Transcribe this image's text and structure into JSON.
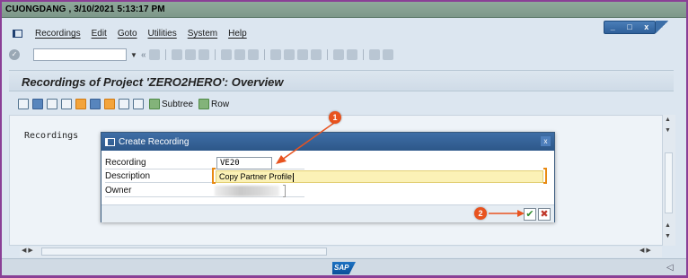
{
  "topbar": {
    "text": "CUONGDANG  ,  3/10/2021 5:13:17 PM"
  },
  "window_controls": {
    "minimize": "_",
    "maximize": "□",
    "close": "x"
  },
  "menubar": {
    "items": [
      {
        "label": "Recordings"
      },
      {
        "label": "Edit"
      },
      {
        "label": "Goto"
      },
      {
        "label": "Utilities"
      },
      {
        "label": "System"
      },
      {
        "label": "Help"
      }
    ]
  },
  "toolbar": {
    "command_field_value": "",
    "back_symbol": "«"
  },
  "screen": {
    "title": "Recordings of Project 'ZERO2HERO': Overview"
  },
  "app_toolbar": {
    "subtree_label": "Subtree",
    "row_label": "Row"
  },
  "content": {
    "recordings_label": "Recordings"
  },
  "dialog": {
    "title": "Create Recording",
    "close_symbol": "x",
    "fields": {
      "recording": {
        "label": "Recording",
        "value": "VE20"
      },
      "description": {
        "label": "Description",
        "value": "Copy Partner Profile"
      },
      "owner": {
        "label": "Owner",
        "value": ""
      }
    },
    "ok_symbol": "✔",
    "cancel_symbol": "✖"
  },
  "annotations": {
    "badge_1": "1",
    "badge_2": "2",
    "color": "#e8531f"
  },
  "colors": {
    "frame": "#8a3f96",
    "title_bar": "#2d5789",
    "highlight_field": "#fbf1b6"
  },
  "statusbar": {
    "logo": "SAP"
  }
}
